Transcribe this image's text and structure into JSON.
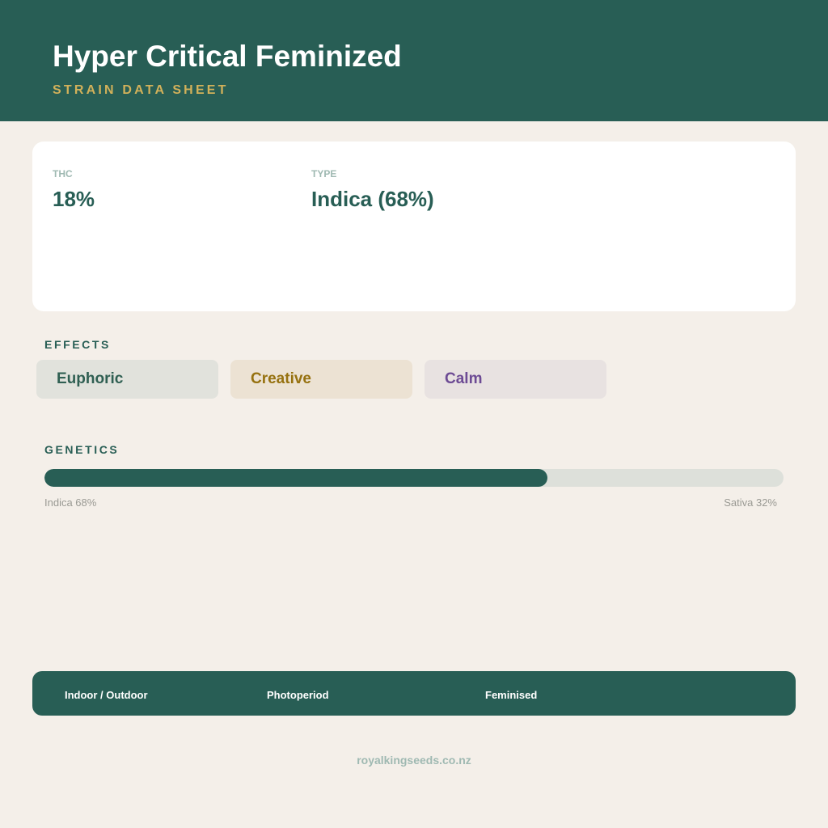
{
  "header": {
    "title": "Hyper Critical Feminized",
    "subtitle": "STRAIN DATA SHEET"
  },
  "stats": {
    "thc_label": "THC",
    "thc_value": "18%",
    "type_label": "TYPE",
    "type_value": "Indica (68%)"
  },
  "effects": {
    "title": "EFFECTS",
    "items": [
      {
        "label": "Euphoric",
        "text_color": "#2f5f52",
        "bg_color": "#e1e2dc"
      },
      {
        "label": "Creative",
        "text_color": "#96710f",
        "bg_color": "#ece2d3"
      },
      {
        "label": "Calm",
        "text_color": "#6d4b94",
        "bg_color": "#e8e2e1"
      }
    ]
  },
  "genetics": {
    "title": "GENETICS",
    "indica_percent": 68,
    "indica_label": "Indica 68%",
    "sativa_label": "Sativa 32%"
  },
  "footer": {
    "items": [
      "Indoor / Outdoor",
      "Photoperiod",
      "Feminised"
    ]
  },
  "website": "royalkingseeds.co.nz",
  "colors": {
    "primary": "#285e55",
    "accent": "#d2b15a",
    "background": "#f4efe9"
  }
}
